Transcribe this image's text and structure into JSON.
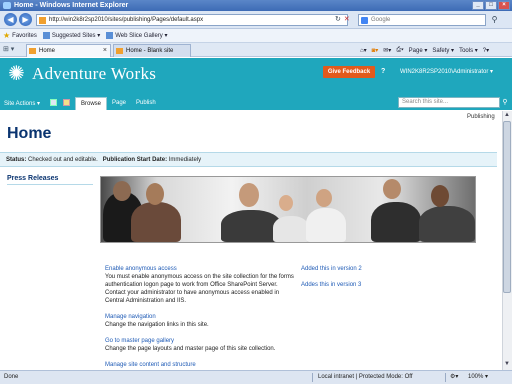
{
  "window": {
    "title": "Home - Windows Internet Explorer"
  },
  "browser": {
    "address": "http://win2k8r2sp2010/sites/publishing/Pages/default.aspx",
    "search_placeholder": "Google",
    "favorites_label": "Favorites",
    "favorites_items": [
      "Suggested Sites ▾",
      "Web Slice Gallery ▾"
    ],
    "tabs": [
      {
        "label": "Home",
        "active": true
      },
      {
        "label": "Home - Blank site",
        "active": false
      }
    ],
    "command_items": [
      "Page ▾",
      "Safety ▾",
      "Tools ▾"
    ]
  },
  "sharepoint": {
    "site_name": "Adventure Works",
    "feedback_label": "Give Feedback",
    "help_label": "?",
    "user_label": "WIN2K8R2SP2010\\Administrator ▾",
    "site_actions_label": "Site Actions ▾",
    "ribbon_tabs": [
      "Browse",
      "Page",
      "Publish"
    ],
    "search_placeholder": "Search this site...",
    "page_title": "Home",
    "publishing_label": "Publishing",
    "status": {
      "status_label": "Status:",
      "status_value": "Checked out and editable.",
      "pub_label": "Publication Start Date:",
      "pub_value": "Immediately"
    },
    "left_nav_heading": "Press Releases",
    "links": [
      {
        "title": "Enable anonymous access",
        "desc": "You must enable anonymous access on the site collection for the forms authentication logon page to work from Office SharePoint Server. Contact your administrator to have anonymous access enabled in Central Administration and IIS."
      },
      {
        "title": "Manage navigation",
        "desc": "Change the navigation links in this site."
      },
      {
        "title": "Go to master page gallery",
        "desc": "Change the page layouts and master page of this site collection."
      },
      {
        "title": "Manage site content and structure",
        "desc": ""
      }
    ],
    "right_links": [
      "Added this in version 2",
      "Addes this in version 3"
    ]
  },
  "status_bar": {
    "left": "Done",
    "zone": "Local intranet | Protected Mode: Off",
    "zoom": "100% ▾"
  },
  "colors": {
    "brand": "#1fa7bd",
    "feedback": "#e25a1c",
    "link": "#1f5bb6",
    "title": "#0a3470"
  }
}
